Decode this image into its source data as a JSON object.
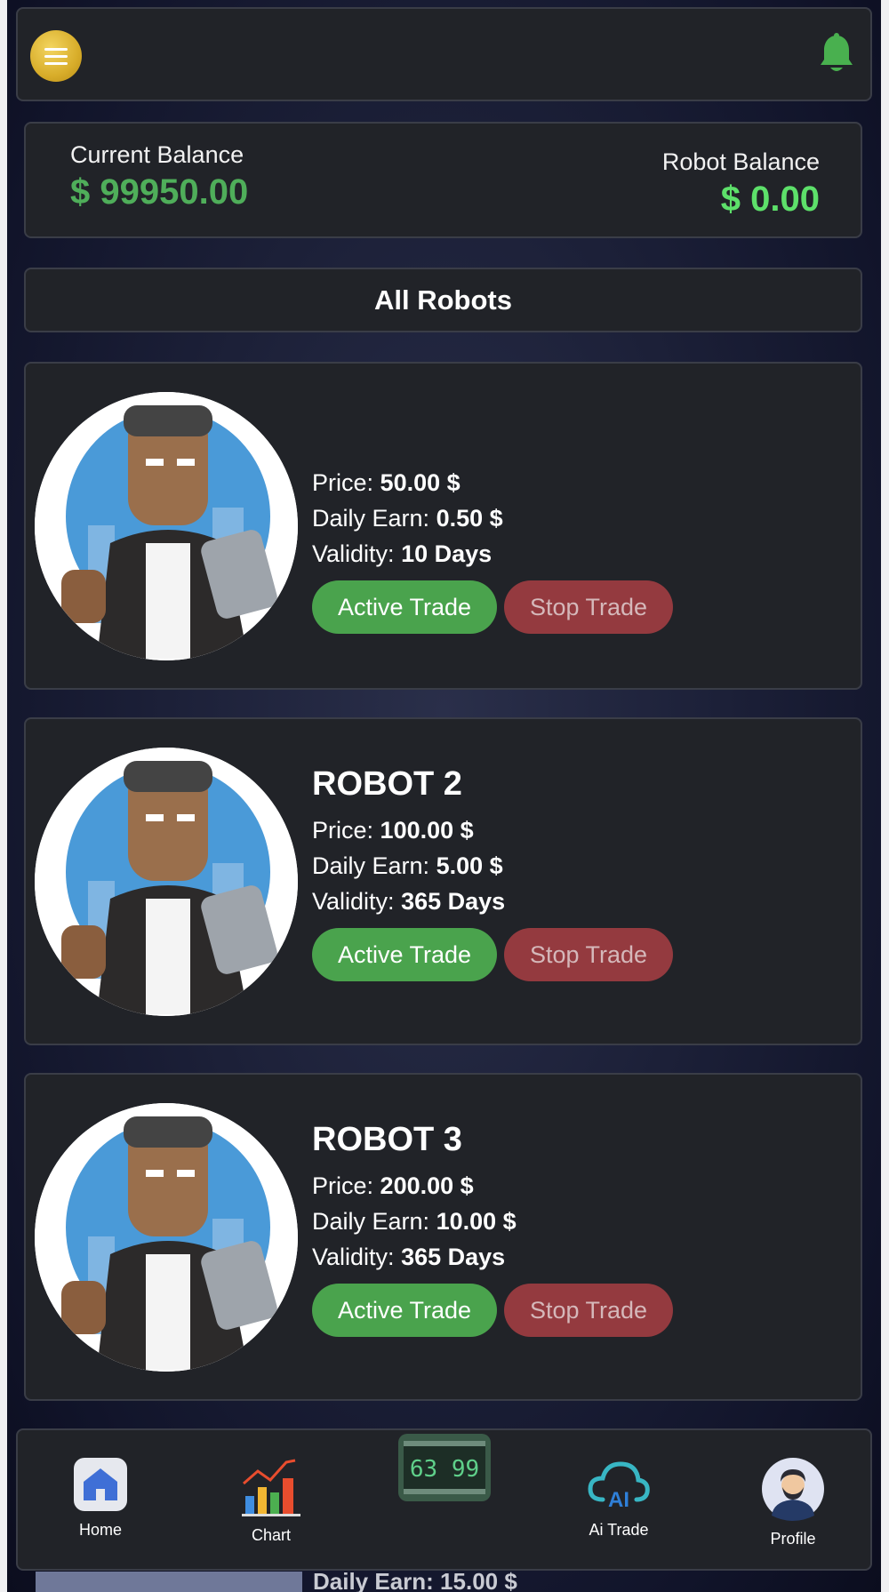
{
  "header": {
    "menu_icon": "hamburger-icon",
    "bell_icon": "bell-icon"
  },
  "balance": {
    "current_label": "Current Balance",
    "current_value": "$ 99950.00",
    "robot_label": "Robot Balance",
    "robot_value": "$ 0.00"
  },
  "section_title": "All Robots",
  "robots": [
    {
      "name": "",
      "price_label": "Price:",
      "price": "50.00 $",
      "earn_label": "Daily Earn:",
      "earn": "0.50 $",
      "validity_label": "Validity:",
      "validity": "10 Days",
      "active_label": "Active Trade",
      "stop_label": "Stop Trade"
    },
    {
      "name": "ROBOT 2",
      "price_label": "Price:",
      "price": "100.00 $",
      "earn_label": "Daily Earn:",
      "earn": "5.00 $",
      "validity_label": "Validity:",
      "validity": "365 Days",
      "active_label": "Active Trade",
      "stop_label": "Stop Trade"
    },
    {
      "name": "ROBOT 3",
      "price_label": "Price:",
      "price": "200.00 $",
      "earn_label": "Daily Earn:",
      "earn": "10.00 $",
      "validity_label": "Validity:",
      "validity": "365 Days",
      "active_label": "Active Trade",
      "stop_label": "Stop Trade"
    }
  ],
  "peek_text": "Daily Earn: 15.00 $",
  "nav": [
    {
      "label": "Home",
      "icon": "home-icon"
    },
    {
      "label": "Chart",
      "icon": "chart-icon"
    },
    {
      "label": "",
      "icon": "counter-icon",
      "counter": "63 99"
    },
    {
      "label": "Ai Trade",
      "icon": "ai-cloud-icon"
    },
    {
      "label": "Profile",
      "icon": "profile-avatar-icon"
    }
  ],
  "colors": {
    "green": "#4aa34d",
    "red": "#943a3f",
    "balance_green": "#5de06a",
    "gold": "#d8ad2a"
  }
}
